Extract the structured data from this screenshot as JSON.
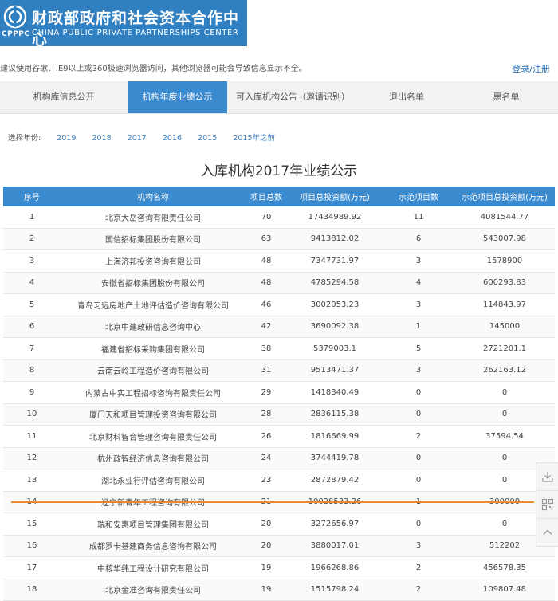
{
  "header": {
    "logo_cn": "财政部政府和社会资本合作中心",
    "logo_en": "CHINA PUBLIC PRIVATE PARTNERSHIPS CENTER",
    "logo_abbr": "CPPPC"
  },
  "notice": "建议使用谷歌、IE9以上或360极速浏览器访问，其他浏览器可能会导致信息显示不全。",
  "login_label": "登录/注册",
  "tabs": [
    {
      "label": "机构库信息公开"
    },
    {
      "label": "机构年度业绩公示"
    },
    {
      "label": "可入库机构公告（邀请识别）"
    },
    {
      "label": "退出名单"
    },
    {
      "label": "黑名单"
    }
  ],
  "year_filter": {
    "label": "选择年份:",
    "years": [
      "2019",
      "2018",
      "2017",
      "2016",
      "2015",
      "2015年之前"
    ]
  },
  "page_title": "入库机构2017年业绩公示",
  "table": {
    "headers": [
      "序号",
      "机构名称",
      "项目总数",
      "项目总投资额(万元)",
      "示范项目数",
      "示范项目总投资额(万元)"
    ],
    "rows": [
      [
        "1",
        "北京大岳咨询有限责任公司",
        "70",
        "17434989.92",
        "11",
        "4081544.77"
      ],
      [
        "2",
        "国信招标集团股份有限公司",
        "63",
        "9413812.02",
        "6",
        "543007.98"
      ],
      [
        "3",
        "上海济邦投资咨询有限公司",
        "48",
        "7347731.97",
        "3",
        "1578900"
      ],
      [
        "4",
        "安徽省招标集团股份有限公司",
        "48",
        "4785294.58",
        "4",
        "600293.83"
      ],
      [
        "5",
        "青岛习远房地产土地评估造价咨询有限公司",
        "46",
        "3002053.23",
        "3",
        "114843.97"
      ],
      [
        "6",
        "北京中建政研信息咨询中心",
        "42",
        "3690092.38",
        "1",
        "145000"
      ],
      [
        "7",
        "福建省招标采购集团有限公司",
        "38",
        "5379003.1",
        "5",
        "2721201.1"
      ],
      [
        "8",
        "云南云岭工程造价咨询有限公司",
        "31",
        "9513471.37",
        "3",
        "262163.12"
      ],
      [
        "9",
        "内蒙古中实工程招标咨询有限责任公司",
        "29",
        "1418340.49",
        "0",
        "0"
      ],
      [
        "10",
        "厦门天和项目管理投资咨询有限公司",
        "28",
        "2836115.38",
        "0",
        "0"
      ],
      [
        "11",
        "北京财科智合管理咨询有限责任公司",
        "26",
        "1816669.99",
        "2",
        "37594.54"
      ],
      [
        "12",
        "杭州政智经济信息咨询有限公司",
        "24",
        "3744419.78",
        "0",
        "0"
      ],
      [
        "13",
        "湖北永业行评估咨询有限公司",
        "23",
        "2872879.42",
        "0",
        "0"
      ],
      [
        "14",
        "辽宁新青年工程咨询有限公司",
        "21",
        "10028533.26",
        "1",
        "300000"
      ],
      [
        "15",
        "瑞和安惠项目管理集团有限公司",
        "20",
        "3272656.97",
        "0",
        "0"
      ],
      [
        "16",
        "成都罗卡基建商务信息咨询有限公司",
        "20",
        "3880017.01",
        "3",
        "512202"
      ],
      [
        "17",
        "中核华纬工程设计研究有限公司",
        "19",
        "1966268.86",
        "2",
        "456578.35"
      ],
      [
        "18",
        "北京金准咨询有限责任公司",
        "19",
        "1515798.24",
        "2",
        "109807.48"
      ]
    ]
  },
  "side_tools": [
    {
      "icon": "download-icon"
    },
    {
      "icon": "qrcode-icon"
    },
    {
      "icon": "chevron-up-icon"
    }
  ],
  "colors": {
    "brand_blue": "#2f7fc1",
    "tab_active": "#3a8ad0",
    "table_header": "#3a8ad0",
    "highlight": "#e88a2e"
  }
}
